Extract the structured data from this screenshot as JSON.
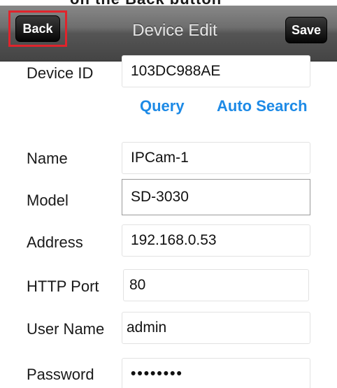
{
  "top_caption": "on the Back button",
  "nav": {
    "title": "Device Edit",
    "back_label": "Back",
    "save_label": "Save"
  },
  "fields": {
    "device_id": {
      "label": "Device ID",
      "value": "103DC988AE"
    },
    "name": {
      "label": "Name",
      "value": "IPCam-1"
    },
    "model": {
      "label": "Model",
      "value": "SD-3030"
    },
    "address": {
      "label": "Address",
      "value": "192.168.0.53"
    },
    "http_port": {
      "label": "HTTP Port",
      "value": "80"
    },
    "user_name": {
      "label": "User Name",
      "value": "admin"
    },
    "password": {
      "label": "Password",
      "value": "••••••••"
    }
  },
  "links": {
    "query": "Query",
    "auto_search": "Auto Search"
  },
  "colors": {
    "link": "#1d8ae6",
    "highlight": "#e0242c",
    "nav_bar": "#555555"
  }
}
